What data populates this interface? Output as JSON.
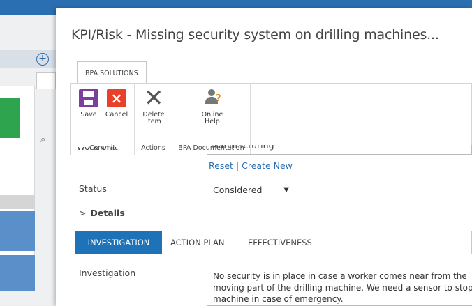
{
  "background": {
    "plus_icon": "+",
    "search_icon_glyph": "⌕"
  },
  "dialog": {
    "title": "KPI/Risk - Missing security system on drilling machines..."
  },
  "ribbon": {
    "tab_label": "BPA SOLUTIONS",
    "groups": {
      "commit": {
        "label": "Commit",
        "save_label": "Save",
        "cancel_label": "Cancel"
      },
      "actions": {
        "label": "Actions",
        "delete_label_1": "Delete",
        "delete_label_2": "Item"
      },
      "documentation": {
        "label": "BPA Documentation",
        "help_label_1": "Online",
        "help_label_2": "Help"
      }
    }
  },
  "form": {
    "work_unit_label": "Work Unit",
    "work_unit_value": "Manufacturing",
    "reset_link": "Reset",
    "link_separator": "|",
    "create_new_link": "Create New",
    "status_label": "Status",
    "status_value": "Considered",
    "details_label": "Details",
    "tabs": [
      {
        "label": "INVESTIGATION"
      },
      {
        "label": "ACTION PLAN"
      },
      {
        "label": "EFFECTIVENESS"
      }
    ],
    "investigation_label": "Investigation",
    "investigation_text": "No security is in place in case a worker comes near from the\nmoving part of the drilling machine. We need a sensor to stop\nmachine in case of emergency."
  },
  "colors": {
    "accent": "#1d72b8",
    "link": "#2b6fb3",
    "save_icon": "#7b3f9e",
    "cancel_icon": "#e8412b"
  }
}
